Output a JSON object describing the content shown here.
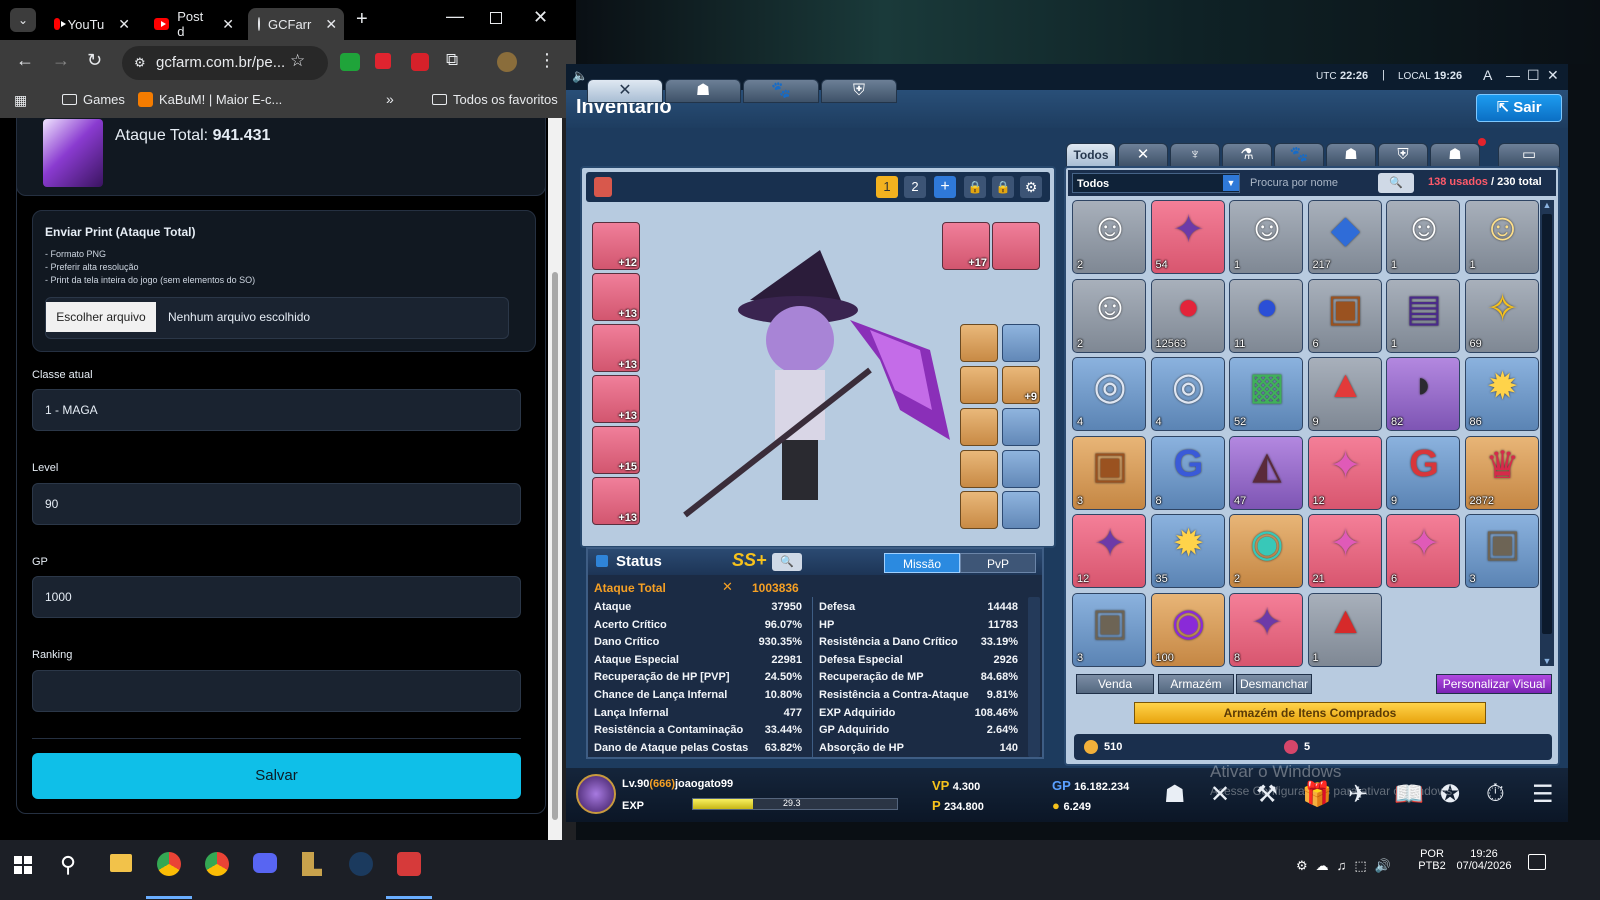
{
  "browser": {
    "tabs": [
      {
        "title": "YouTu"
      },
      {
        "title": "Post d"
      },
      {
        "title": "GCFarr"
      }
    ],
    "url": "gcfarm.com.br/pe...",
    "bookmarks": [
      "Games",
      "KaBuM! | Maior E-c...",
      "Todos os favoritos"
    ]
  },
  "form": {
    "attack_label": "Ataque Total:",
    "attack_value": "941.431",
    "upload_title": "Enviar Print (Ataque Total)",
    "upload_hints": [
      "- Formato PNG",
      "- Preferir alta resolução",
      "- Print da tela inteira do jogo (sem elementos do SO)"
    ],
    "choose_file": "Escolher arquivo",
    "no_file": "Nenhum arquivo escolhido",
    "class_label": "Classe atual",
    "class_value": "1 - MAGA",
    "level_label": "Level",
    "level_value": "90",
    "gp_label": "GP",
    "gp_value": "1000",
    "ranking_label": "Ranking",
    "ranking_value": "",
    "save": "Salvar"
  },
  "game": {
    "utc_label": "UTC",
    "utc_time": "22:26",
    "local_label": "LOCAL",
    "local_time": "19:26",
    "title": "Inventário",
    "exit": "Sair",
    "preset_1": "1",
    "preset_2": "2",
    "equip_enhance": [
      "+12",
      "+13",
      "+13",
      "+13",
      "+15",
      "+13"
    ],
    "weapon_enhance": "+17",
    "acc_enhance": "+9",
    "status": {
      "title": "Status",
      "grade": "SS+",
      "mode_mission": "Missão",
      "mode_pvp": "PvP",
      "total_label": "Ataque Total",
      "total_value": "1003836",
      "left": [
        [
          "Ataque",
          "37950"
        ],
        [
          "Acerto Crítico",
          "96.07%"
        ],
        [
          "Dano Crítico",
          "930.35%"
        ],
        [
          "Ataque Especial",
          "22981"
        ],
        [
          "Recuperação de HP [PVP]",
          "24.50%"
        ],
        [
          "Chance de Lança Infernal",
          "10.80%"
        ],
        [
          "Lança Infernal",
          "477"
        ],
        [
          "Resistência a Contaminação",
          "33.44%"
        ],
        [
          "Dano de Ataque pelas Costas",
          "63.82%"
        ]
      ],
      "right": [
        [
          "Defesa",
          "14448"
        ],
        [
          "HP",
          "11783"
        ],
        [
          "Resistência a Dano Crítico",
          "33.19%"
        ],
        [
          "Defesa Especial",
          "2926"
        ],
        [
          "Recuperação de MP",
          "84.68%"
        ],
        [
          "Resistência a Contra-Ataque",
          "9.81%"
        ],
        [
          "EXP Adquirido",
          "108.46%"
        ],
        [
          "GP Adquirido",
          "2.64%"
        ],
        [
          "Absorção de HP",
          "140"
        ]
      ]
    },
    "inventory": {
      "tab_all": "Todos",
      "filter": "Todos",
      "search_placeholder": "Procura por nome",
      "used": "138 usados",
      "total": "/ 230 total",
      "items": [
        {
          "color": "grey",
          "count": "2",
          "icon": "chicken-face"
        },
        {
          "color": "pink",
          "count": "54",
          "icon": "purple-crystal"
        },
        {
          "color": "grey",
          "count": "1",
          "icon": "sleepy-face"
        },
        {
          "color": "grey",
          "count": "217",
          "icon": "blue-gem"
        },
        {
          "color": "grey",
          "count": "1",
          "icon": "smile-face"
        },
        {
          "color": "grey",
          "count": "1",
          "icon": "wink-face"
        },
        {
          "color": "grey",
          "count": "2",
          "icon": "happy-face"
        },
        {
          "color": "grey",
          "count": "12563",
          "icon": "red-potion"
        },
        {
          "color": "grey",
          "count": "11",
          "icon": "blue-potion"
        },
        {
          "color": "grey",
          "count": "6",
          "icon": "treasure-chest"
        },
        {
          "color": "grey",
          "count": "1",
          "icon": "purple-bag"
        },
        {
          "color": "grey",
          "count": "69",
          "icon": "gold-potion"
        },
        {
          "color": "blue",
          "count": "4",
          "icon": "ring"
        },
        {
          "color": "blue",
          "count": "4",
          "icon": "ring"
        },
        {
          "color": "blue",
          "count": "52",
          "icon": "green-box"
        },
        {
          "color": "grey",
          "count": "9",
          "icon": "red-hat"
        },
        {
          "color": "purple",
          "count": "82",
          "icon": "dark-helmet"
        },
        {
          "color": "blue",
          "count": "86",
          "icon": "golden-burst"
        },
        {
          "color": "orange",
          "count": "3",
          "icon": "treasure-chest"
        },
        {
          "color": "blue",
          "count": "8",
          "icon": "g-potion"
        },
        {
          "color": "purple",
          "count": "47",
          "icon": "dark-ship"
        },
        {
          "color": "pink",
          "count": "12",
          "icon": "pink-crystal"
        },
        {
          "color": "blue",
          "count": "9",
          "icon": "g-flask"
        },
        {
          "color": "orange",
          "count": "2872",
          "icon": "crown-potion"
        },
        {
          "color": "pink",
          "count": "12",
          "icon": "purple-crystal"
        },
        {
          "color": "blue",
          "count": "35",
          "icon": "golden-burst"
        },
        {
          "color": "orange",
          "count": "2",
          "icon": "teal-orb"
        },
        {
          "color": "pink",
          "count": "21",
          "icon": "pink-crystal"
        },
        {
          "color": "pink",
          "count": "6",
          "icon": "pink-crystal"
        },
        {
          "color": "blue",
          "count": "3",
          "icon": "stone-chest"
        },
        {
          "color": "blue",
          "count": "3",
          "icon": "stone-chest"
        },
        {
          "color": "orange",
          "count": "100",
          "icon": "purple-orb"
        },
        {
          "color": "pink",
          "count": "8",
          "icon": "purple-crystal"
        },
        {
          "color": "grey",
          "count": "1",
          "icon": "red-flask"
        }
      ],
      "btn_sell": "Venda",
      "btn_storage": "Armazém",
      "btn_dismantle": "Desmanchar",
      "btn_custom": "Personalizar Visual",
      "btn_purchased": "Armazém de Itens Comprados",
      "currency_1": "510",
      "currency_2": "5"
    },
    "player": {
      "level_prefix": "Lv.90",
      "rank": "(666)",
      "name": "joaogato99",
      "exp_label": "EXP",
      "exp_value": "29.3",
      "exp_fraction": 0.293,
      "vp": "4.300",
      "gold": "234.800",
      "gp": "16.182.234",
      "coin": "6.249"
    },
    "watermark_1": "Ativar o Windows",
    "watermark_2": "Acesse Configurações para ativar o Windows."
  },
  "taskbar": {
    "lang": "POR",
    "layout": "PTB2",
    "time": "19:26",
    "date": "07/04/2026"
  }
}
